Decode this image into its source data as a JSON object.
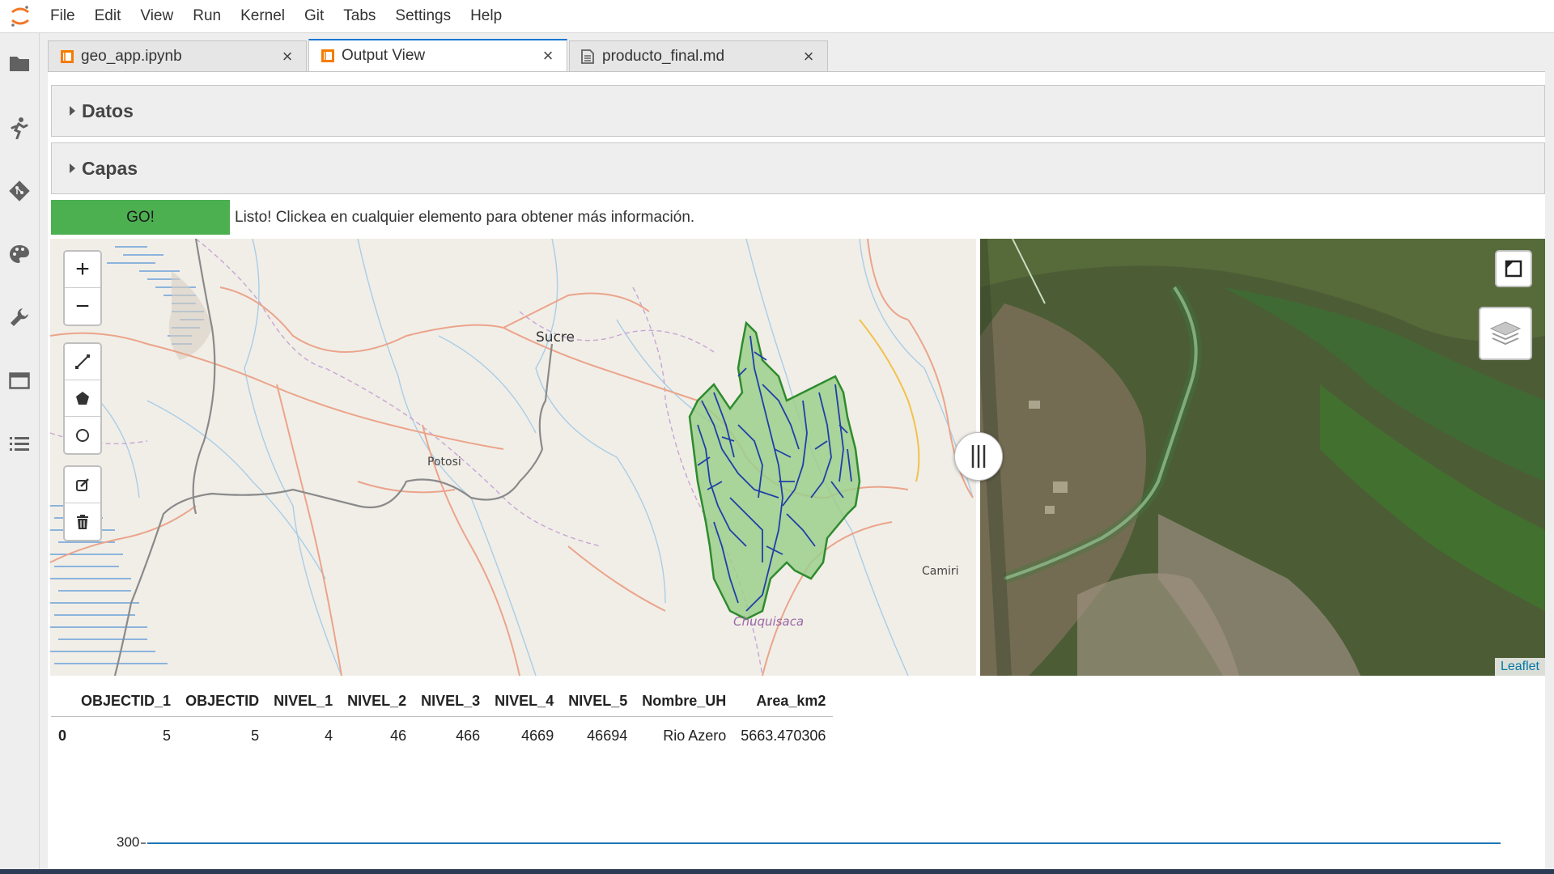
{
  "menu": {
    "items": [
      "File",
      "Edit",
      "View",
      "Run",
      "Kernel",
      "Git",
      "Tabs",
      "Settings",
      "Help"
    ]
  },
  "sidebar": {
    "icons": [
      "folder-icon",
      "running-icon",
      "git-icon",
      "palette-icon",
      "wrench-icon",
      "tab-window-icon",
      "toc-list-icon"
    ]
  },
  "tabs": [
    {
      "label": "geo_app.ipynb",
      "icon": "notebook-icon",
      "active": false
    },
    {
      "label": "Output View",
      "icon": "notebook-icon",
      "active": true
    },
    {
      "label": "producto_final.md",
      "icon": "markdown-file-icon",
      "active": false
    }
  ],
  "accordions": {
    "datos": "Datos",
    "capas": "Capas"
  },
  "go_button": "GO!",
  "status_message": "Listo! Clickea en cualquier elemento para obtener más información.",
  "map": {
    "labels": {
      "sucre": "Sucre",
      "potosi": "Potosi",
      "camiri": "Camiri",
      "chuquisaca": "Chuquisaca"
    },
    "zoom_in": "+",
    "zoom_out": "−",
    "attribution": "Leaflet",
    "colors": {
      "basin_fill": "#9ccf8c",
      "basin_stroke": "#2e8b2e",
      "river": "#1f3fa8"
    }
  },
  "table": {
    "columns": [
      "",
      "OBJECTID_1",
      "OBJECTID",
      "NIVEL_1",
      "NIVEL_2",
      "NIVEL_3",
      "NIVEL_4",
      "NIVEL_5",
      "Nombre_UH",
      "Area_km2"
    ],
    "rows": [
      [
        "0",
        "5",
        "5",
        "4",
        "46",
        "466",
        "4669",
        "46694",
        "Rio Azero",
        "5663.470306"
      ]
    ]
  },
  "plot": {
    "tick_label": "300"
  }
}
